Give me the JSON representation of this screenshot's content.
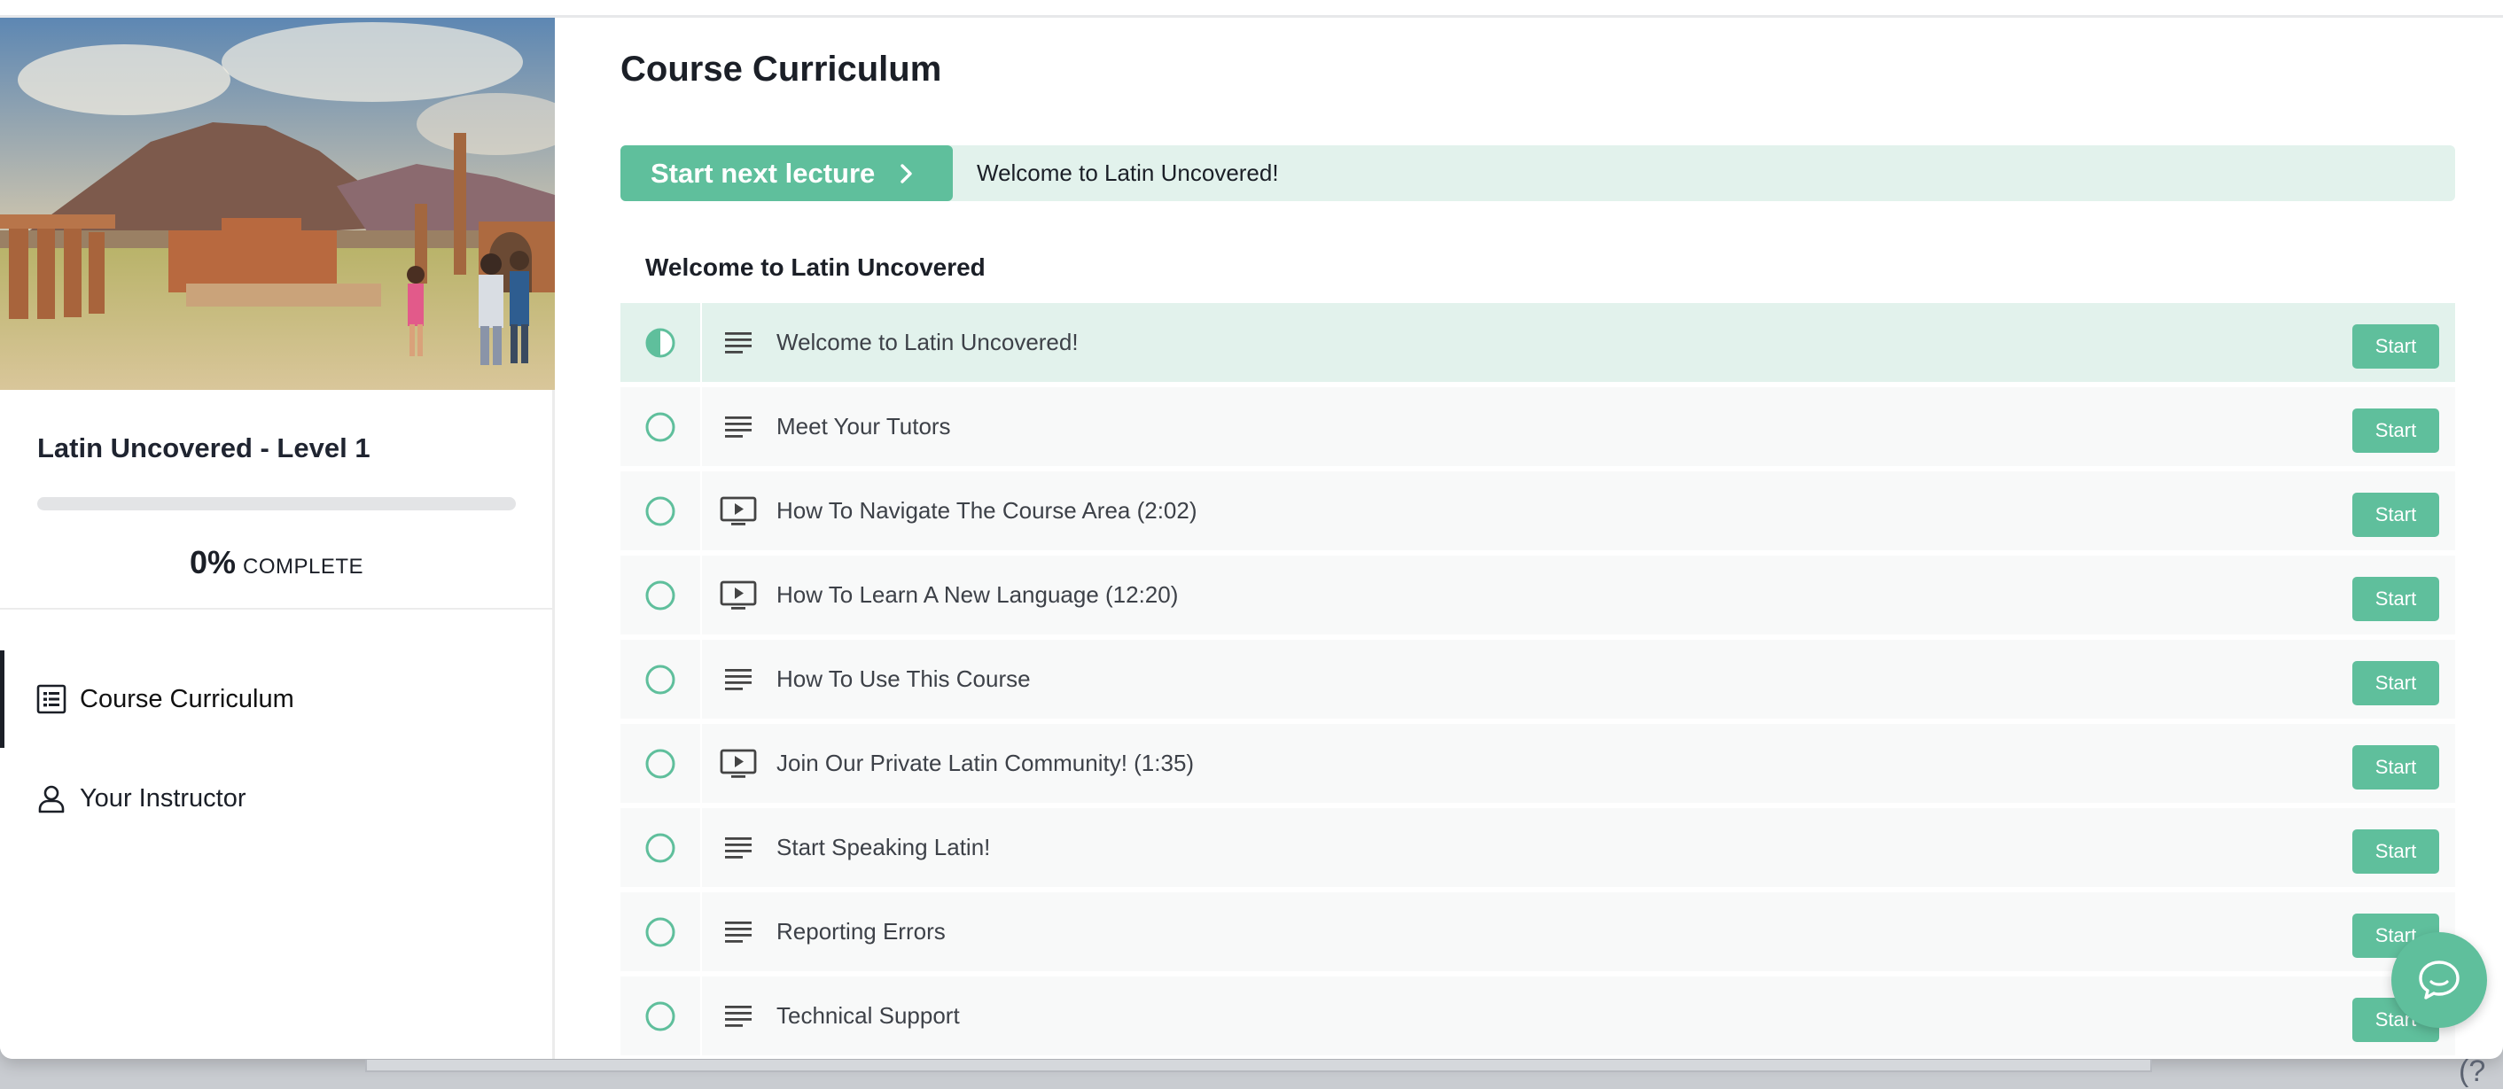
{
  "sidebar": {
    "course_title": "Latin Uncovered - Level 1",
    "progress": {
      "percent": 0,
      "percent_label": "0%",
      "complete_label": "COMPLETE"
    },
    "nav": [
      {
        "label": "Course Curriculum",
        "icon": "list-icon",
        "active": true
      },
      {
        "label": "Your Instructor",
        "icon": "person-icon",
        "active": false
      }
    ]
  },
  "main": {
    "title": "Course Curriculum",
    "start_next": {
      "button_label": "Start next lecture",
      "lecture_title": "Welcome to Latin Uncovered!"
    },
    "section": {
      "title": "Welcome to Latin Uncovered",
      "lectures": [
        {
          "title": "Welcome to Latin Uncovered!",
          "type": "text",
          "status": "in-progress",
          "button": "Start"
        },
        {
          "title": "Meet Your Tutors",
          "type": "text",
          "status": "not-started",
          "button": "Start"
        },
        {
          "title": "How To Navigate The Course Area (2:02)",
          "type": "video",
          "status": "not-started",
          "button": "Start"
        },
        {
          "title": "How To Learn A New Language (12:20)",
          "type": "video",
          "status": "not-started",
          "button": "Start"
        },
        {
          "title": "How To Use This Course",
          "type": "text",
          "status": "not-started",
          "button": "Start"
        },
        {
          "title": "Join Our Private Latin Community! (1:35)",
          "type": "video",
          "status": "not-started",
          "button": "Start"
        },
        {
          "title": "Start Speaking Latin!",
          "type": "text",
          "status": "not-started",
          "button": "Start"
        },
        {
          "title": "Reporting Errors",
          "type": "text",
          "status": "not-started",
          "button": "Start"
        },
        {
          "title": "Technical Support",
          "type": "text",
          "status": "not-started",
          "button": "Start"
        }
      ]
    }
  },
  "icons": {
    "text_lecture": "text-lines-icon",
    "video_lecture": "video-play-icon",
    "chat": "chat-bubble-icon",
    "chevron": "chevron-right-icon"
  },
  "colors": {
    "accent": "#5fbf9c",
    "accent_light": "#e2f2ec",
    "text_dark": "#1b1f27",
    "row_bg": "#f8f9f9"
  }
}
